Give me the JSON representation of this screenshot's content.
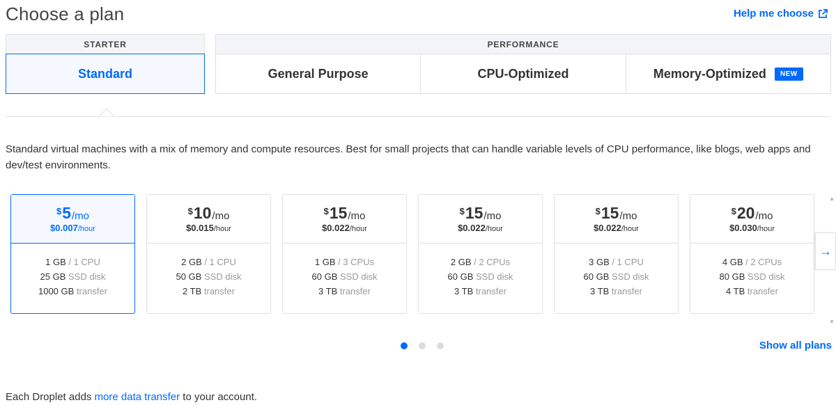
{
  "header": {
    "title": "Choose a plan",
    "help_label": "Help me choose",
    "help_icon": "external-link-icon"
  },
  "groups": {
    "starter": {
      "label": "STARTER",
      "tabs": [
        {
          "label": "Standard",
          "active": true
        }
      ]
    },
    "performance": {
      "label": "PERFORMANCE",
      "tabs": [
        {
          "label": "General Purpose"
        },
        {
          "label": "CPU-Optimized"
        },
        {
          "label": "Memory-Optimized",
          "badge": "NEW"
        }
      ]
    }
  },
  "description": "Standard virtual machines with a mix of memory and compute resources. Best for small projects that can handle variable levels of CPU performance, like blogs, web apps and dev/test environments.",
  "plans": [
    {
      "currency": "$",
      "price": "5",
      "per": "/mo",
      "hourly": "$0.007",
      "hourly_unit": "/hour",
      "mem": "1 GB",
      "cpu": "1 CPU",
      "disk": "25 GB",
      "disk_label": "SSD disk",
      "transfer": "1000 GB",
      "transfer_label": "transfer",
      "selected": true
    },
    {
      "currency": "$",
      "price": "10",
      "per": "/mo",
      "hourly": "$0.015",
      "hourly_unit": "/hour",
      "mem": "2 GB",
      "cpu": "1 CPU",
      "disk": "50 GB",
      "disk_label": "SSD disk",
      "transfer": "2 TB",
      "transfer_label": "transfer"
    },
    {
      "currency": "$",
      "price": "15",
      "per": "/mo",
      "hourly": "$0.022",
      "hourly_unit": "/hour",
      "mem": "1 GB",
      "cpu": "3 CPUs",
      "disk": "60 GB",
      "disk_label": "SSD disk",
      "transfer": "3 TB",
      "transfer_label": "transfer"
    },
    {
      "currency": "$",
      "price": "15",
      "per": "/mo",
      "hourly": "$0.022",
      "hourly_unit": "/hour",
      "mem": "2 GB",
      "cpu": "2 CPUs",
      "disk": "60 GB",
      "disk_label": "SSD disk",
      "transfer": "3 TB",
      "transfer_label": "transfer"
    },
    {
      "currency": "$",
      "price": "15",
      "per": "/mo",
      "hourly": "$0.022",
      "hourly_unit": "/hour",
      "mem": "3 GB",
      "cpu": "1 CPU",
      "disk": "60 GB",
      "disk_label": "SSD disk",
      "transfer": "3 TB",
      "transfer_label": "transfer"
    },
    {
      "currency": "$",
      "price": "20",
      "per": "/mo",
      "hourly": "$0.030",
      "hourly_unit": "/hour",
      "mem": "4 GB",
      "cpu": "2 CPUs",
      "disk": "80 GB",
      "disk_label": "SSD disk",
      "transfer": "4 TB",
      "transfer_label": "transfer"
    }
  ],
  "carousel": {
    "next_icon": "arrow-right-icon",
    "pages": 3,
    "active_page": 1
  },
  "show_all_label": "Show all plans",
  "footer": {
    "prefix": "Each Droplet adds ",
    "link": "more data transfer",
    "suffix": " to your account."
  },
  "colors": {
    "accent": "#0069ff",
    "border": "#dfdfdf",
    "header_bg": "#f3f5f9"
  }
}
